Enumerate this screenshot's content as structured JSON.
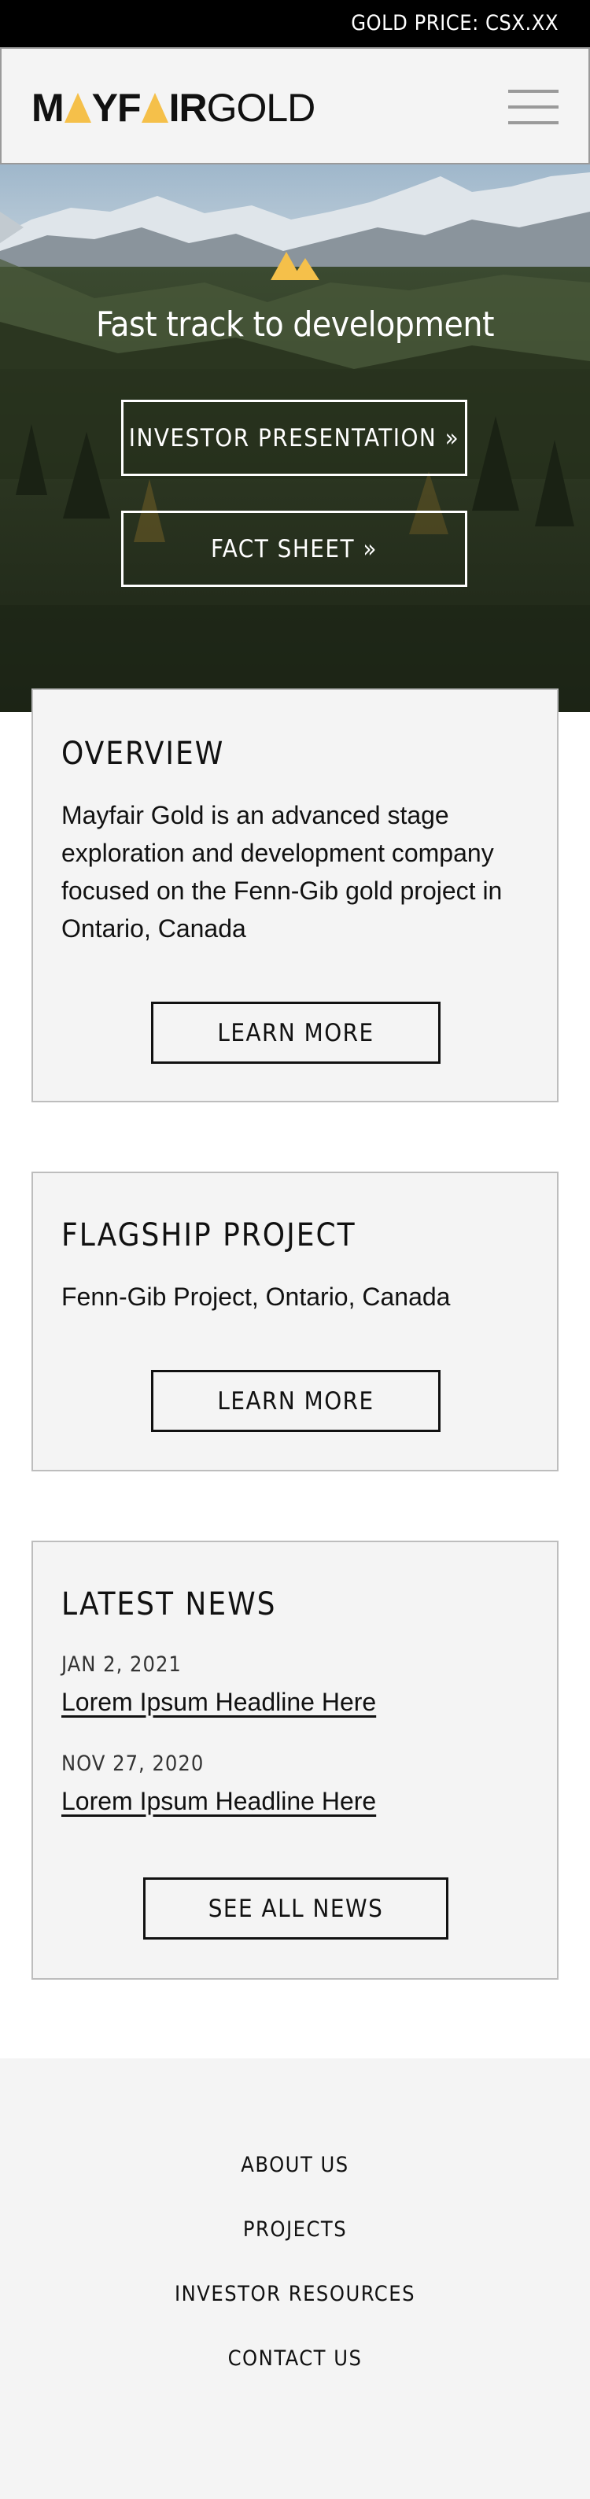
{
  "topbar": {
    "gold_price": "GOLD PRICE: CSX.XX"
  },
  "header": {
    "logo_bold": "MAYFAIR",
    "logo_light": "GOLD",
    "menu_icon": "hamburger-menu-icon"
  },
  "hero": {
    "icon": "mountains-icon",
    "title": "Fast track to development",
    "buttons": [
      "INVESTOR PRESENTATION »",
      "FACT SHEET »"
    ]
  },
  "overview": {
    "heading": "OVERVIEW",
    "body": "Mayfair Gold is an advanced stage exploration and development company focused on the Fenn-Gib gold project in Ontario, Canada",
    "button": "LEARN MORE"
  },
  "flagship": {
    "heading": "FLAGSHIP PROJECT",
    "body": "Fenn-Gib Project, Ontario, Canada",
    "button": "LEARN MORE"
  },
  "news": {
    "heading": "LATEST NEWS",
    "items": [
      {
        "date": "JAN 2, 2021",
        "headline": "Lorem Ipsum Headline Here"
      },
      {
        "date": "NOV 27, 2020",
        "headline": "Lorem Ipsum Headline Here"
      }
    ],
    "button": "SEE ALL NEWS"
  },
  "footer": {
    "links": [
      "ABOUT US",
      "PROJECTS",
      "INVESTOR RESOURCES",
      "CONTACT US"
    ]
  },
  "colors": {
    "accent_gold": "#f5c04a",
    "topbar_bg": "#000000",
    "card_bg": "#f4f4f4",
    "footer_bg": "#f4f4f4"
  }
}
